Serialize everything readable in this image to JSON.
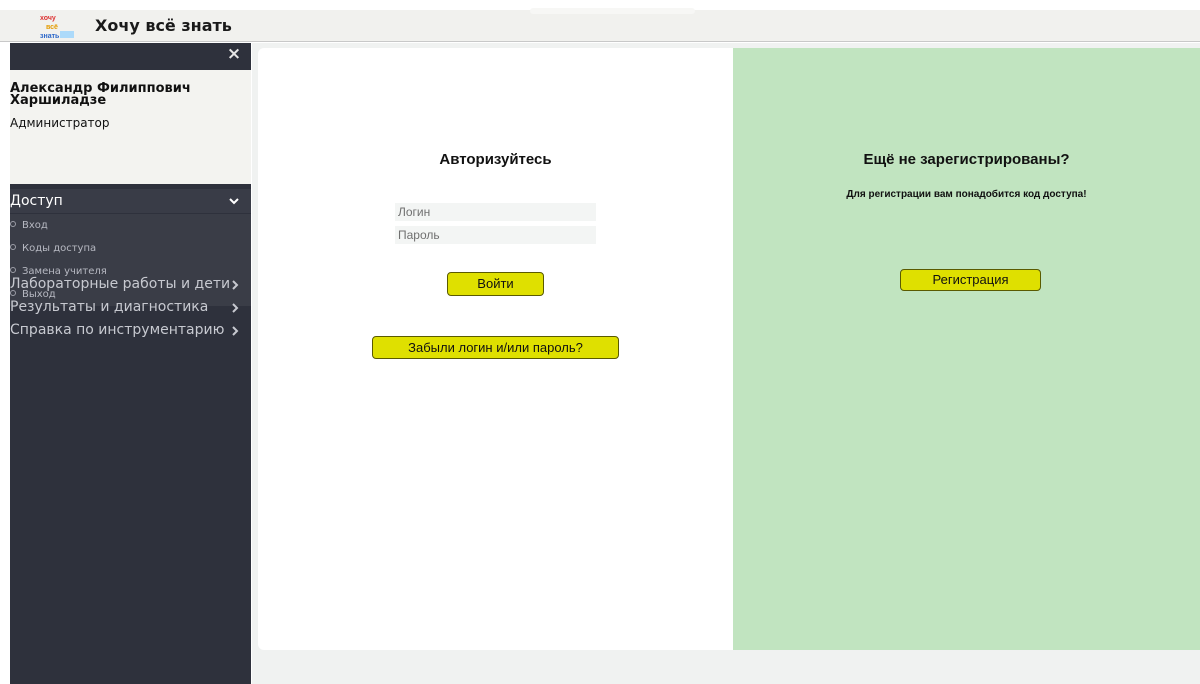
{
  "app": {
    "title": "Хочу всё знать",
    "logo_lines": [
      "хочу",
      "всё",
      "знать"
    ]
  },
  "sidebar": {
    "close_glyph": "×",
    "user": {
      "name_line1": "Александр Филиппович",
      "name_line2": "Харшиладзе",
      "role": "Администратор"
    },
    "section": {
      "label": "Доступ",
      "chevron": "⌄",
      "items": [
        {
          "label": "Вход"
        },
        {
          "label": "Коды доступа"
        },
        {
          "label": "Замена учителя"
        },
        {
          "label": "Выход"
        }
      ]
    },
    "nav": [
      {
        "label": "Лабораторные работы и дети",
        "chevron": "›"
      },
      {
        "label": "Результаты и диагностика",
        "chevron": "›"
      },
      {
        "label": "Справка по инструментарию",
        "chevron": "›"
      }
    ]
  },
  "login": {
    "title": "Авторизуйтесь",
    "login_placeholder": "Логин",
    "password_placeholder": "Пароль",
    "submit_label": "Войти",
    "forgot_label": "Забыли логин и/или пароль?"
  },
  "register": {
    "title": "Ещё не зарегистрированы?",
    "note": "Для регистрации вам понадобится код доступа!",
    "button_label": "Регистрация"
  },
  "colors": {
    "sidebar_bg": "#2e313c",
    "register_panel_bg": "#c1e4c0",
    "button_yellow": "#dfe000"
  }
}
